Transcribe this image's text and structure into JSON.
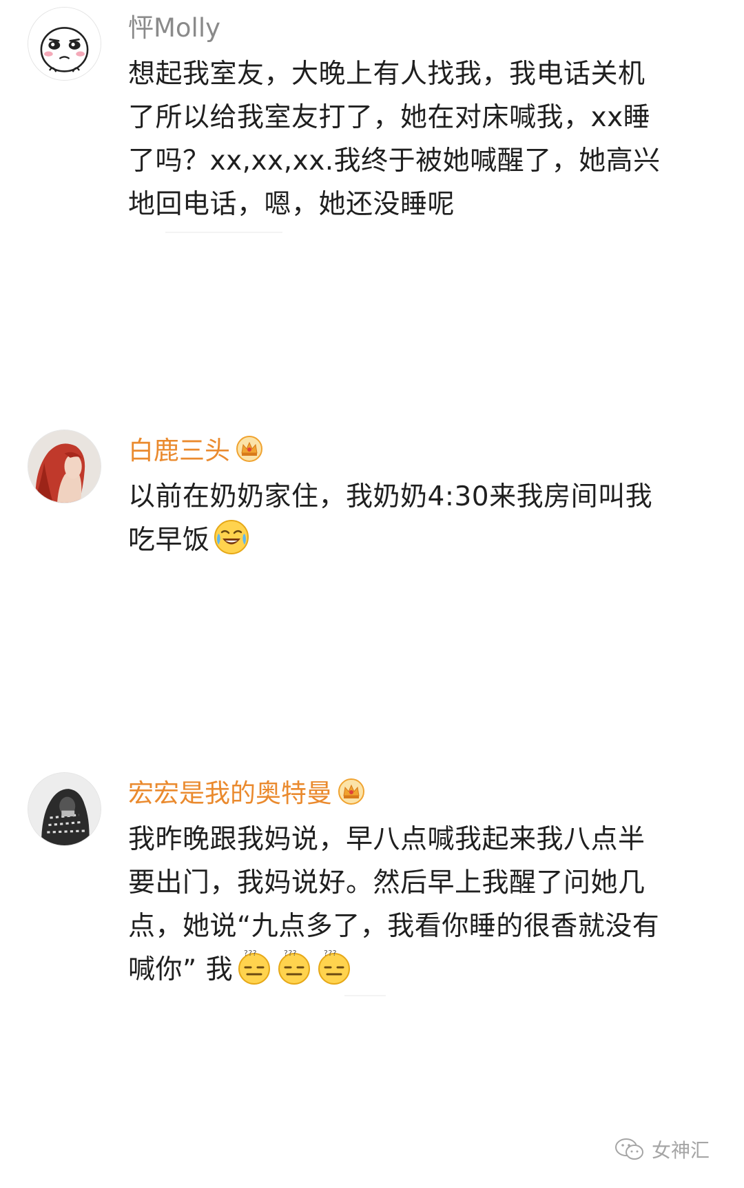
{
  "comments": [
    {
      "username": "怦Molly",
      "avatar": "cartoon-face-avatar",
      "vip": false,
      "lines": [
        "想起我室友，大晚上有人找我，我电话关机",
        "了所以给我室友打了，她在对床喊我，xx睡",
        "了吗？xx,xx,xx.我终于被她喊醒了，她高兴",
        "地回电话，嗯，她还没睡呢"
      ]
    },
    {
      "username": "白鹿三头",
      "avatar": "red-hair-portrait-avatar",
      "vip": true,
      "lines": [
        "以前在奶奶家住，我奶奶4:30来我房间叫我",
        "吃早饭"
      ],
      "emoji": "laugh-cry-emoji"
    },
    {
      "username": "宏宏是我的奥特曼",
      "avatar": "hooded-person-avatar",
      "vip": true,
      "lines": [
        "我昨晚跟我妈说，早八点喊我起来我八点半",
        "要出门，我妈说好。然后早上我醒了问她几",
        "点，她说“九点多了，我看你睡的很香就没有",
        "喊你” 我"
      ],
      "emoji": "confused-emoji"
    }
  ],
  "watermark": {
    "text": "女神汇",
    "icon": "wechat-icon"
  },
  "colors": {
    "vip_name": "#ea8a2e",
    "normal_name": "#8a8a8a",
    "text": "#1f1f1f"
  }
}
